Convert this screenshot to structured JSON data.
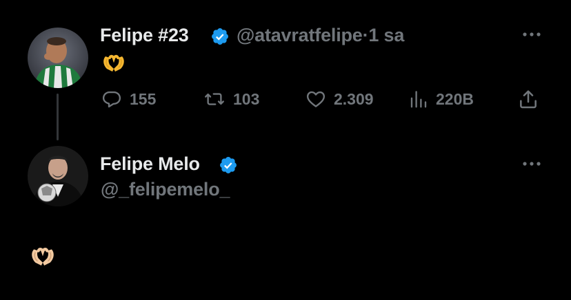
{
  "parent_tweet": {
    "display_name": "Felipe #23",
    "handle": "@atavratfelipe",
    "separator": "·",
    "time": "1 sa",
    "text": "🫶",
    "actions": {
      "replies": "155",
      "reposts": "103",
      "likes": "2.309",
      "views": "220B"
    }
  },
  "reply_tweet": {
    "display_name": "Felipe Melo",
    "handle": "@_felipemelo_",
    "text": "🫶"
  },
  "icons": {
    "verified": "verified-badge-icon",
    "more": "more-dots-icon",
    "reply": "reply-icon",
    "repost": "repost-icon",
    "like": "heart-icon",
    "views": "views-chart-icon",
    "share": "share-icon"
  },
  "colors": {
    "background": "#000000",
    "primary_text": "#e7e9ea",
    "secondary_text": "#71767b",
    "verified_blue": "#1d9bf0",
    "thread_line": "#333639"
  }
}
